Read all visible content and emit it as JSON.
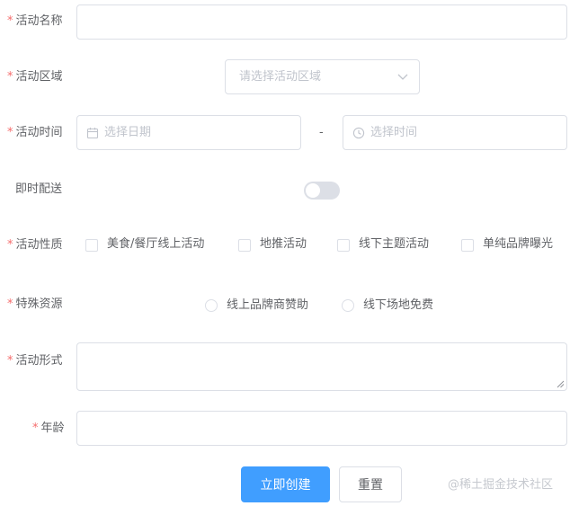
{
  "required_mark": "*",
  "fields": {
    "name": {
      "label": "活动名称",
      "value": ""
    },
    "region": {
      "label": "活动区域",
      "placeholder": "请选择活动区域"
    },
    "time": {
      "label": "活动时间",
      "date_placeholder": "选择日期",
      "separator": "-",
      "time_placeholder": "选择时间"
    },
    "delivery": {
      "label": "即时配送",
      "enabled": false
    },
    "type": {
      "label": "活动性质",
      "options": [
        "美食/餐厅线上活动",
        "地推活动",
        "线下主题活动",
        "单纯品牌曝光"
      ]
    },
    "resource": {
      "label": "特殊资源",
      "options": [
        "线上品牌商赞助",
        "线下场地免费"
      ]
    },
    "form": {
      "label": "活动形式",
      "value": ""
    },
    "age": {
      "label": "年龄",
      "value": ""
    }
  },
  "buttons": {
    "create": "立即创建",
    "reset": "重置"
  },
  "watermark": "@稀土掘金技术社区"
}
